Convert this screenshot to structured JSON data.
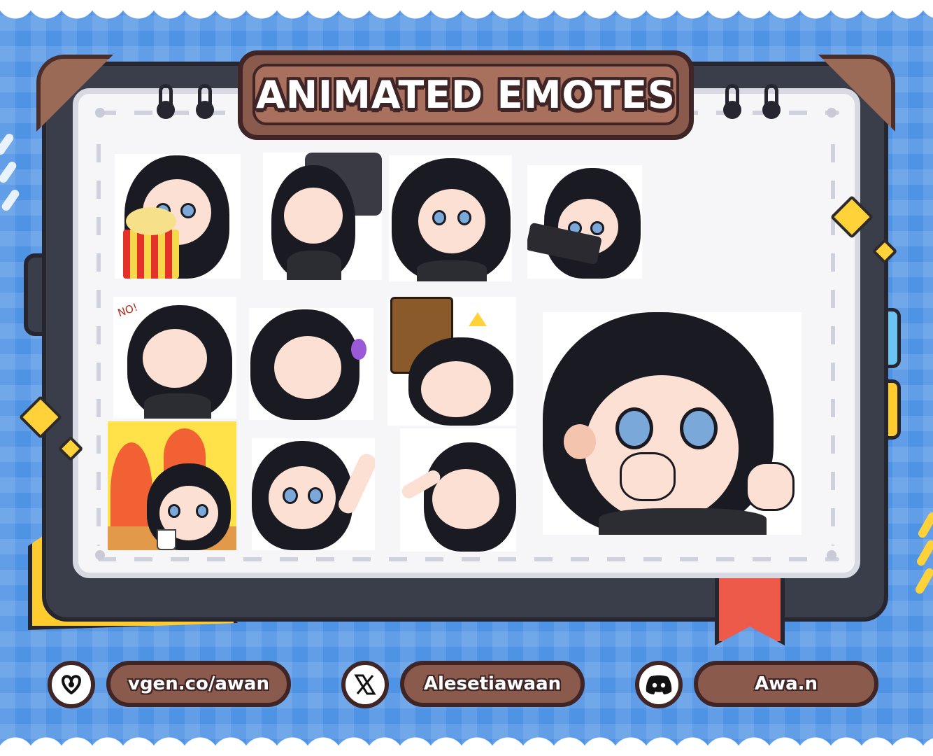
{
  "title": "ANIMATED EMOTES",
  "colors": {
    "background": "#4f93e4",
    "notebook": "#3a3d4a",
    "page": "#f6f6f8",
    "banner": "#a9705d",
    "accent_yellow": "#ffd23a",
    "bookmark": "#ee5a4a"
  },
  "emotes": [
    {
      "name": "emote-popcorn"
    },
    {
      "name": "emote-happy-closed-eyes"
    },
    {
      "name": "emote-smug"
    },
    {
      "name": "emote-gun"
    },
    {
      "name": "emote-no",
      "caption": "NO!"
    },
    {
      "name": "emote-humming"
    },
    {
      "name": "emote-bonk"
    },
    {
      "name": "emote-this-is-fine"
    },
    {
      "name": "emote-wave"
    },
    {
      "name": "emote-point-laugh"
    },
    {
      "name": "emote-pout-large"
    }
  ],
  "socials": [
    {
      "icon": "vgen-icon",
      "label": "vgen.co/awan"
    },
    {
      "icon": "x-icon",
      "label": "Alesetiawaan"
    },
    {
      "icon": "discord-icon",
      "label": "Awa.n"
    }
  ]
}
